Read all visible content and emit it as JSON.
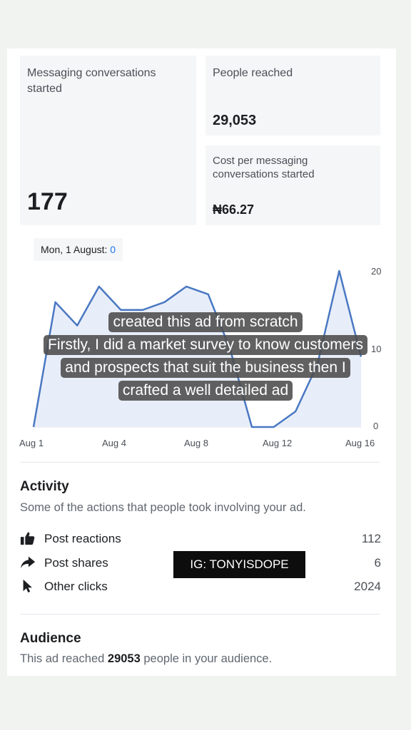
{
  "stats": {
    "messaging": {
      "label": "Messaging conversations started",
      "value": "177"
    },
    "reached": {
      "label": "People reached",
      "value": "29,053"
    },
    "cost": {
      "label": "Cost per messaging conversations started",
      "value": "₦66.27"
    }
  },
  "tooltip": {
    "date": "Mon, 1 August: ",
    "value": "0"
  },
  "chart_data": {
    "type": "line",
    "x": [
      "Aug 1",
      "Aug 2",
      "Aug 3",
      "Aug 4",
      "Aug 5",
      "Aug 6",
      "Aug 7",
      "Aug 8",
      "Aug 9",
      "Aug 10",
      "Aug 11",
      "Aug 12",
      "Aug 13",
      "Aug 14",
      "Aug 15",
      "Aug 16"
    ],
    "x_tick_labels": [
      "Aug 1",
      "Aug 4",
      "Aug 8",
      "Aug 12",
      "Aug 16"
    ],
    "y_ticks": [
      "0",
      "10",
      "20"
    ],
    "ylim": [
      0,
      20
    ],
    "series": [
      {
        "values": [
          0,
          16,
          13,
          18,
          15,
          15,
          16,
          18,
          17,
          10,
          0,
          0,
          2,
          8,
          20,
          9
        ]
      }
    ],
    "colors": {
      "line": "#4a78c2",
      "fill": "#e8eef9",
      "grid": "#e4e6eb"
    }
  },
  "overlay_caption": [
    "created this ad from scratch",
    "Firstly, I did a market survey to know customers",
    "and prospects that suit the business then I",
    "crafted a well detailed ad"
  ],
  "activity": {
    "title": "Activity",
    "subtitle": "Some of the actions that people took involving your ad.",
    "items": [
      {
        "icon": "thumbs-up-icon",
        "label": "Post reactions",
        "value": "112"
      },
      {
        "icon": "share-arrow-icon",
        "label": "Post shares",
        "value": "6"
      },
      {
        "icon": "cursor-icon",
        "label": "Other clicks",
        "value": "2024"
      }
    ]
  },
  "watermark": "IG: TONYISDOPE",
  "audience": {
    "title": "Audience",
    "prefix": "This ad reached ",
    "count": "29053",
    "suffix": " people in your audience."
  }
}
